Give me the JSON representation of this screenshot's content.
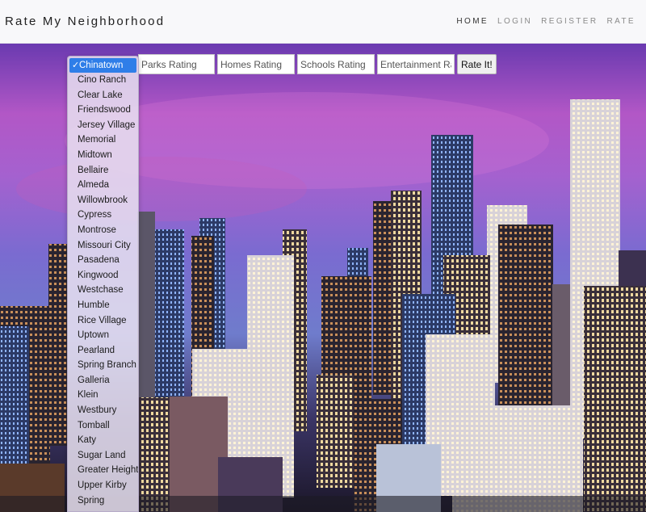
{
  "navbar": {
    "brand": "Rate My Neighborhood",
    "links": [
      {
        "label": "HOME",
        "active": true
      },
      {
        "label": "LOGIN",
        "active": false
      },
      {
        "label": "REGISTER",
        "active": false
      },
      {
        "label": "RATE",
        "active": false
      }
    ]
  },
  "form": {
    "neighborhood_select": {
      "selected": "Chinatown",
      "options": [
        "Chinatown",
        "Cino Ranch",
        "Clear Lake",
        "Friendswood",
        "Jersey Village",
        "Memorial",
        "Midtown",
        "Bellaire",
        "Almeda",
        "Willowbrook",
        "Cypress",
        "Montrose",
        "Missouri City",
        "Pasadena",
        "Kingwood",
        "Westchase",
        "Humble",
        "Rice Village",
        "Uptown",
        "Pearland",
        "Spring Branch",
        "Galleria",
        "Klein",
        "Westbury",
        "Tomball",
        "Katy",
        "Sugar Land",
        "Greater Heights",
        "Upper Kirby",
        "Spring"
      ]
    },
    "parks_placeholder": "Parks Rating",
    "homes_placeholder": "Homes Rating",
    "schools_placeholder": "Schools Rating",
    "entertainment_placeholder": "Entertainment Rating",
    "submit_label": "Rate It!"
  },
  "icons": {
    "check": "checkmark-icon"
  },
  "colors": {
    "selected_option": "#2f7ee8",
    "navbar_bg": "#f8f8fa"
  }
}
